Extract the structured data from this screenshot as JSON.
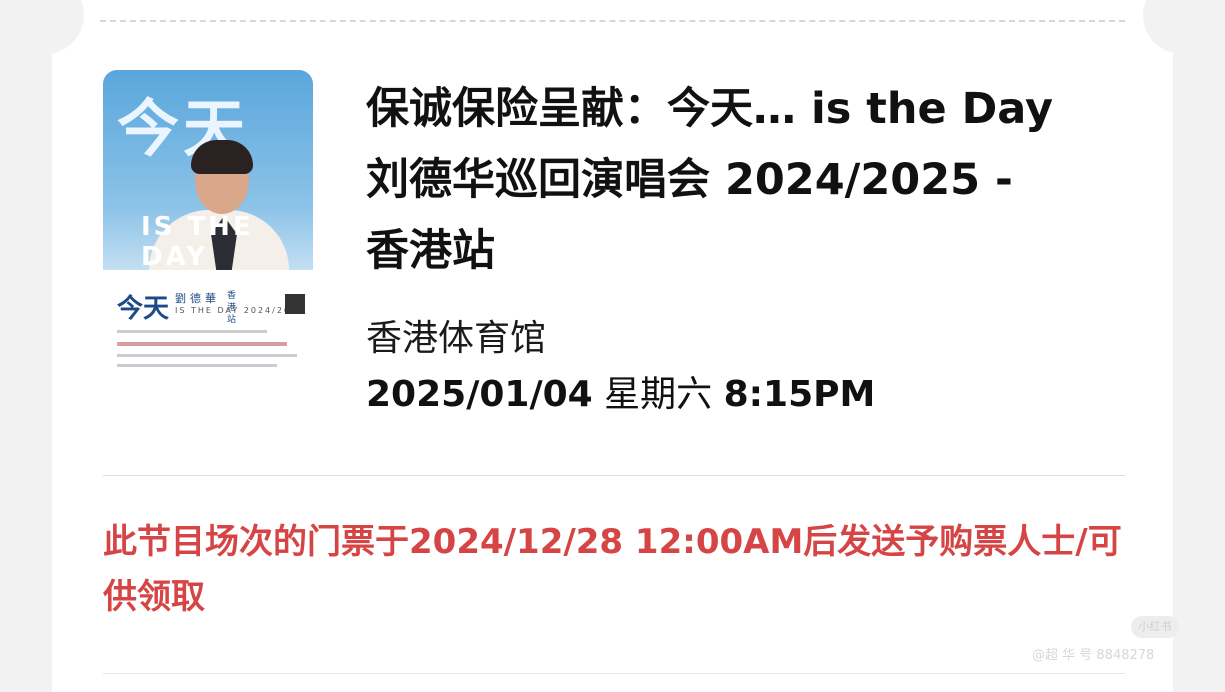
{
  "event": {
    "title": "保诚保险呈献：今天… is the Day 刘德华巡回演唱会 2024/2025 - 香港站",
    "venue": "香港体育馆",
    "date": "2025/01/04",
    "weekday": "星期六",
    "time": "8:15PM"
  },
  "notice": "此节目场次的门票于2024/12/28 12:00AM后发送予购票人士/可供领取",
  "poster": {
    "headline": "今天",
    "overlay": "IS THE DAY",
    "logo": "今天",
    "artist": "劉德華",
    "subtitle": "IS THE DAY 2024/2025",
    "station": "香港站"
  },
  "watermark": {
    "badge": "小红书",
    "handle": "@超 华 号  8848278"
  },
  "colors": {
    "notice": "#d64545",
    "title": "#111111",
    "background": "#f2f2f3"
  }
}
